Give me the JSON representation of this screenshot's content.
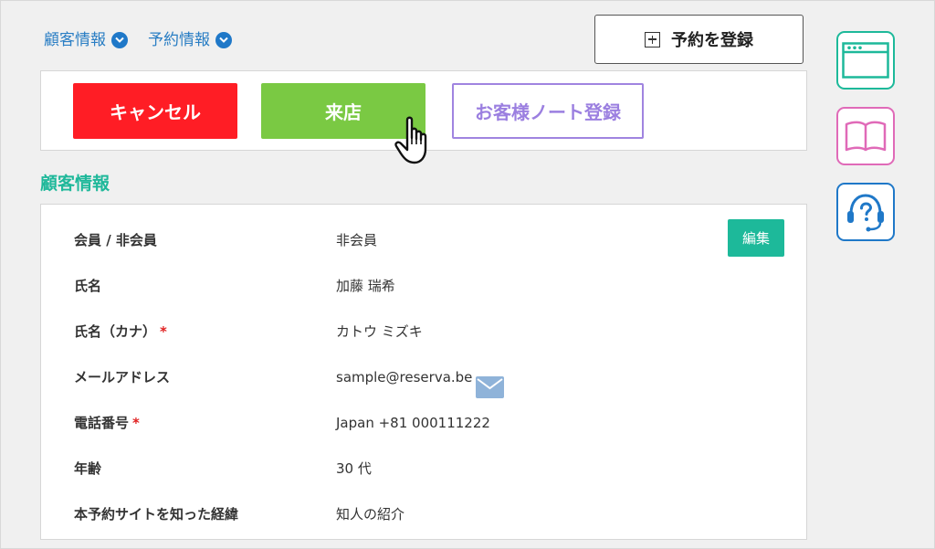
{
  "topnav": {
    "customer_info": "顧客情報",
    "reservation_info": "予約情報"
  },
  "register_button": "予約を登録",
  "actions": {
    "cancel": "キャンセル",
    "visit": "来店",
    "customer_note": "お客様ノート登録"
  },
  "section_title": "顧客情報",
  "edit_button": "編集",
  "fields": [
    {
      "label": "会員 / 非会員",
      "value": "非会員",
      "required": ""
    },
    {
      "label": "氏名",
      "value": "加藤 瑞希",
      "required": ""
    },
    {
      "label": "氏名（カナ）",
      "value": "カトウ ミズキ",
      "required": "*"
    },
    {
      "label": "メールアドレス",
      "value": "sample@reserva.be",
      "required": ""
    },
    {
      "label": "電話番号",
      "value": "Japan +81 000111222",
      "required": "*"
    },
    {
      "label": "年齢",
      "value": "30 代",
      "required": ""
    },
    {
      "label": "本予約サイトを知った経緯",
      "value": "知人の紹介",
      "required": ""
    }
  ],
  "colors": {
    "cancel": "#ff1d25",
    "visit": "#7ac943",
    "note": "#9b7fe0",
    "teal": "#1db99a",
    "link": "#2a7ec4",
    "pink": "#e06ab8",
    "blue": "#1f78c8",
    "required": "#e02020"
  },
  "icons": [
    "chevron-down-icon",
    "plus-box-icon",
    "hand-pointer-icon",
    "mail-icon",
    "browser-window-icon",
    "open-book-icon",
    "headset-help-icon"
  ]
}
